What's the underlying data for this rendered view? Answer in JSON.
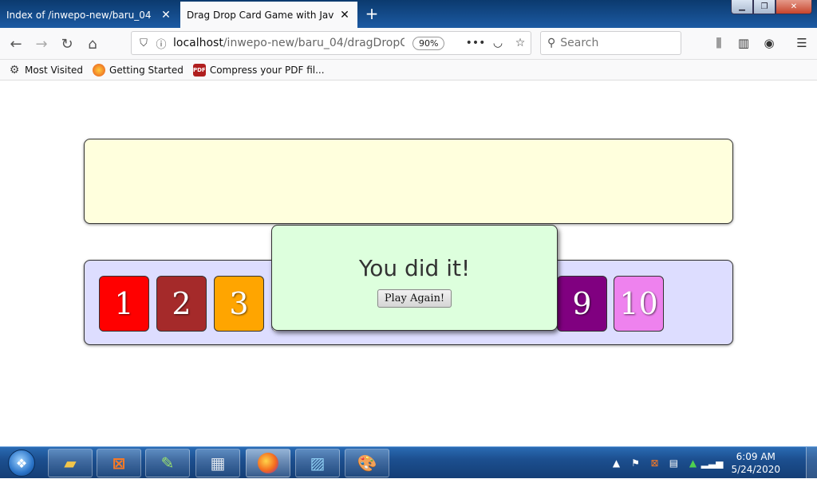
{
  "browser": {
    "tabs": [
      {
        "label": "Index of /inwepo-new/baru_04",
        "active": false
      },
      {
        "label": "Drag Drop Card Game with JavaScri",
        "active": true
      }
    ],
    "url_host": "localhost",
    "url_path": "/inwepo-new/baru_04/dragDropCardG",
    "zoom": "90%",
    "search_placeholder": "Search",
    "bookmarks": [
      "Most Visited",
      "Getting Started",
      "Compress your PDF fil..."
    ]
  },
  "game": {
    "drop_zone_color": "#ffffdd",
    "tray_color": "#ddddff",
    "cards": [
      {
        "label": "1",
        "color": "#ff0000"
      },
      {
        "label": "2",
        "color": "#a52a2a"
      },
      {
        "label": "3",
        "color": "#ffa500"
      },
      {
        "label": "9",
        "color": "#800080"
      },
      {
        "label": "10",
        "color": "#ee82ee"
      }
    ],
    "modal": {
      "title": "You did it!",
      "button_label": "Play Again!",
      "color": "#ddffdd"
    }
  },
  "taskbar": {
    "apps": [
      "explorer-icon",
      "xampp-icon",
      "notepad-plus-icon",
      "calculator-icon",
      "firefox-icon",
      "photos-icon",
      "paint-icon"
    ],
    "clock_time": "6:09 AM",
    "clock_date": "5/24/2020"
  }
}
